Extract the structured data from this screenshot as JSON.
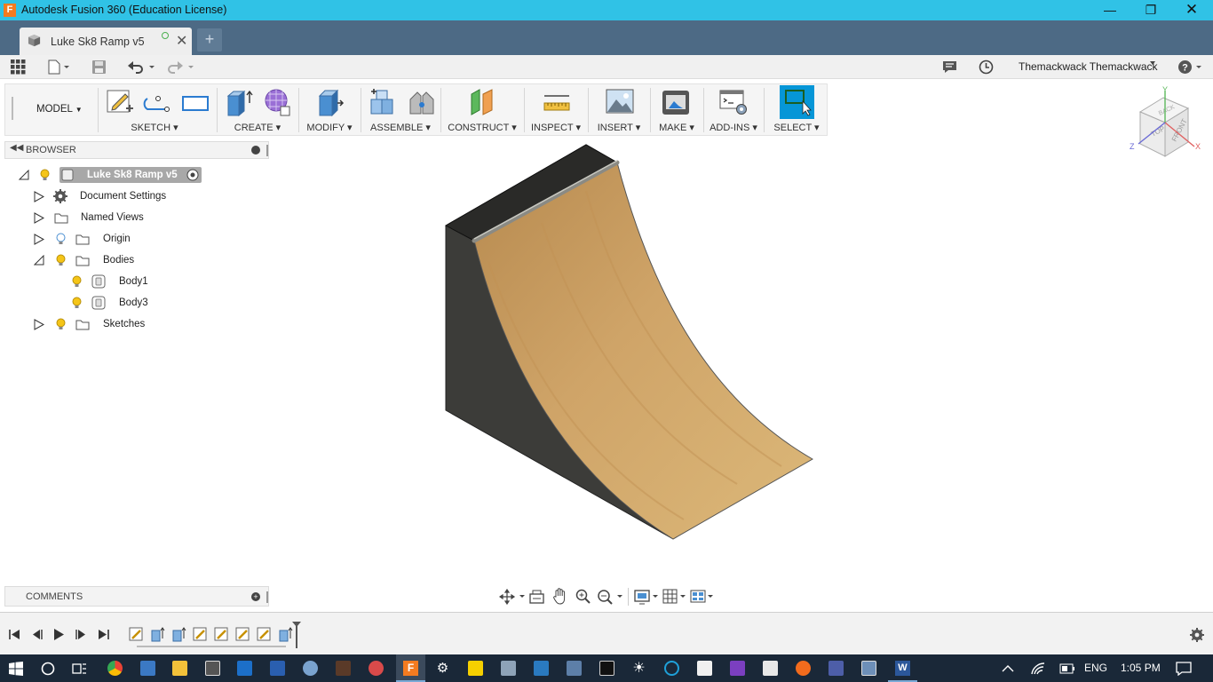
{
  "window": {
    "title": "Autodesk Fusion 360 (Education License)",
    "logo_letter": "F"
  },
  "document_tab": {
    "name": "Luke Sk8 Ramp v5"
  },
  "qat": {
    "user": "Themackwack Themackwack"
  },
  "toolbar": {
    "workspace": "MODEL",
    "groups": [
      {
        "label": "SKETCH"
      },
      {
        "label": "CREATE"
      },
      {
        "label": "MODIFY"
      },
      {
        "label": "ASSEMBLE"
      },
      {
        "label": "CONSTRUCT"
      },
      {
        "label": "INSPECT"
      },
      {
        "label": "INSERT"
      },
      {
        "label": "MAKE"
      },
      {
        "label": "ADD-INS"
      },
      {
        "label": "SELECT"
      }
    ]
  },
  "browser": {
    "header": "BROWSER",
    "root": "Luke Sk8 Ramp v5",
    "items": [
      {
        "label": "Document Settings"
      },
      {
        "label": "Named Views"
      },
      {
        "label": "Origin"
      },
      {
        "label": "Bodies"
      },
      {
        "label": "Body1"
      },
      {
        "label": "Body3"
      },
      {
        "label": "Sketches"
      }
    ]
  },
  "comments": {
    "header": "COMMENTS"
  },
  "viewcube": {
    "top": "TOP",
    "front": "FRONT",
    "back": "BACK",
    "x": "X",
    "y": "Y",
    "z": "Z"
  },
  "taskbar": {
    "language": "ENG",
    "time": "1:05 PM"
  },
  "colors": {
    "titlebar": "#30c2e6",
    "tabbar": "#4d6a85",
    "select_accent": "#0696d7",
    "wood": "#c9a063",
    "ramp_side": "#3d3d3a"
  }
}
